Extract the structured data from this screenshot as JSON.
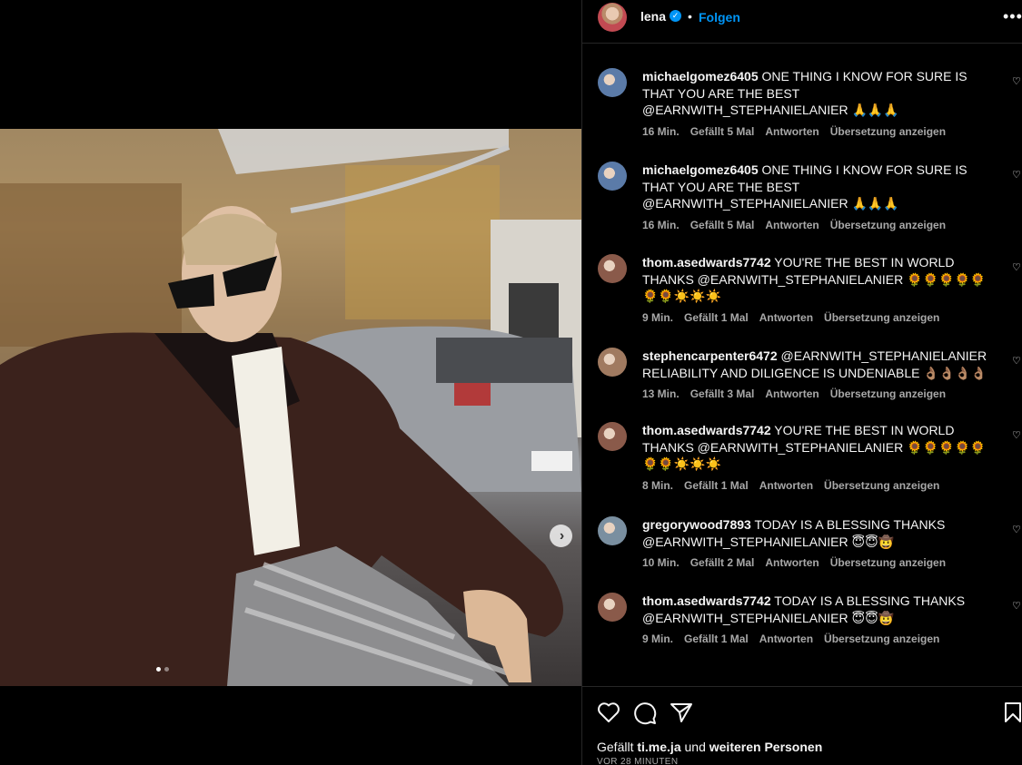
{
  "header": {
    "username": "lena",
    "separator": "•",
    "follow_label": "Folgen",
    "more_label": "•••"
  },
  "carousel": {
    "next_icon": "chevron-right-icon",
    "next_glyph": "›",
    "current_slide": 1,
    "total_slides": 2
  },
  "comments": [
    {
      "username": "michaelgomez6405",
      "text": "ONE THING I KNOW FOR SURE IS THAT YOU ARE THE BEST @EARNWITH_STEPHANIELANIER 🙏🙏🙏",
      "time": "16 Min.",
      "likes": "Gefällt 5 Mal",
      "reply": "Antworten",
      "translate": "Übersetzung anzeigen",
      "avatar_color": "#5b7ba8"
    },
    {
      "username": "michaelgomez6405",
      "text": "ONE THING I KNOW FOR SURE IS THAT YOU ARE THE BEST @EARNWITH_STEPHANIELANIER 🙏🙏🙏",
      "time": "16 Min.",
      "likes": "Gefällt 5 Mal",
      "reply": "Antworten",
      "translate": "Übersetzung anzeigen",
      "avatar_color": "#5b7ba8"
    },
    {
      "username": "thom.asedwards7742",
      "text": "YOU'RE THE BEST IN WORLD THANKS @EARNWITH_STEPHANIELANIER 🌻🌻🌻🌻🌻🌻🌻☀️☀️☀️",
      "time": "9 Min.",
      "likes": "Gefällt 1 Mal",
      "reply": "Antworten",
      "translate": "Übersetzung anzeigen",
      "avatar_color": "#8a5a4a"
    },
    {
      "username": "stephencarpenter6472",
      "text": "@EARNWITH_STEPHANIELANIER RELIABILITY AND DILIGENCE IS UNDENIABLE 👌🏽👌🏽👌🏽👌🏽",
      "time": "13 Min.",
      "likes": "Gefällt 3 Mal",
      "reply": "Antworten",
      "translate": "Übersetzung anzeigen",
      "avatar_color": "#a07a60"
    },
    {
      "username": "thom.asedwards7742",
      "text": "YOU'RE THE BEST IN WORLD THANKS @EARNWITH_STEPHANIELANIER 🌻🌻🌻🌻🌻🌻🌻☀️☀️☀️",
      "time": "8 Min.",
      "likes": "Gefällt 1 Mal",
      "reply": "Antworten",
      "translate": "Übersetzung anzeigen",
      "avatar_color": "#8a5a4a"
    },
    {
      "username": "gregorywood7893",
      "text": "TODAY IS A BLESSING THANKS @EARNWITH_STEPHANIELANIER 😇😇🤠",
      "time": "10 Min.",
      "likes": "Gefällt 2 Mal",
      "reply": "Antworten",
      "translate": "Übersetzung anzeigen",
      "avatar_color": "#7a8fa0"
    },
    {
      "username": "thom.asedwards7742",
      "text": "TODAY IS A BLESSING THANKS @EARNWITH_STEPHANIELANIER 😇😇🤠",
      "time": "9 Min.",
      "likes": "Gefällt 1 Mal",
      "reply": "Antworten",
      "translate": "Übersetzung anzeigen",
      "avatar_color": "#8a5a4a"
    }
  ],
  "load_more_glyph": "+",
  "comment_like_glyph": "♡",
  "footer": {
    "likes_prefix": "Gefällt",
    "liked_by": "ti.me.ja",
    "likes_middle": "und",
    "likes_suffix": "weiteren Personen",
    "time_ago": "VOR 28 MINUTEN"
  },
  "colors": {
    "accent": "#0095f6",
    "text": "#f5f5f5",
    "secondary": "#a8a8a8",
    "background": "#000000"
  }
}
